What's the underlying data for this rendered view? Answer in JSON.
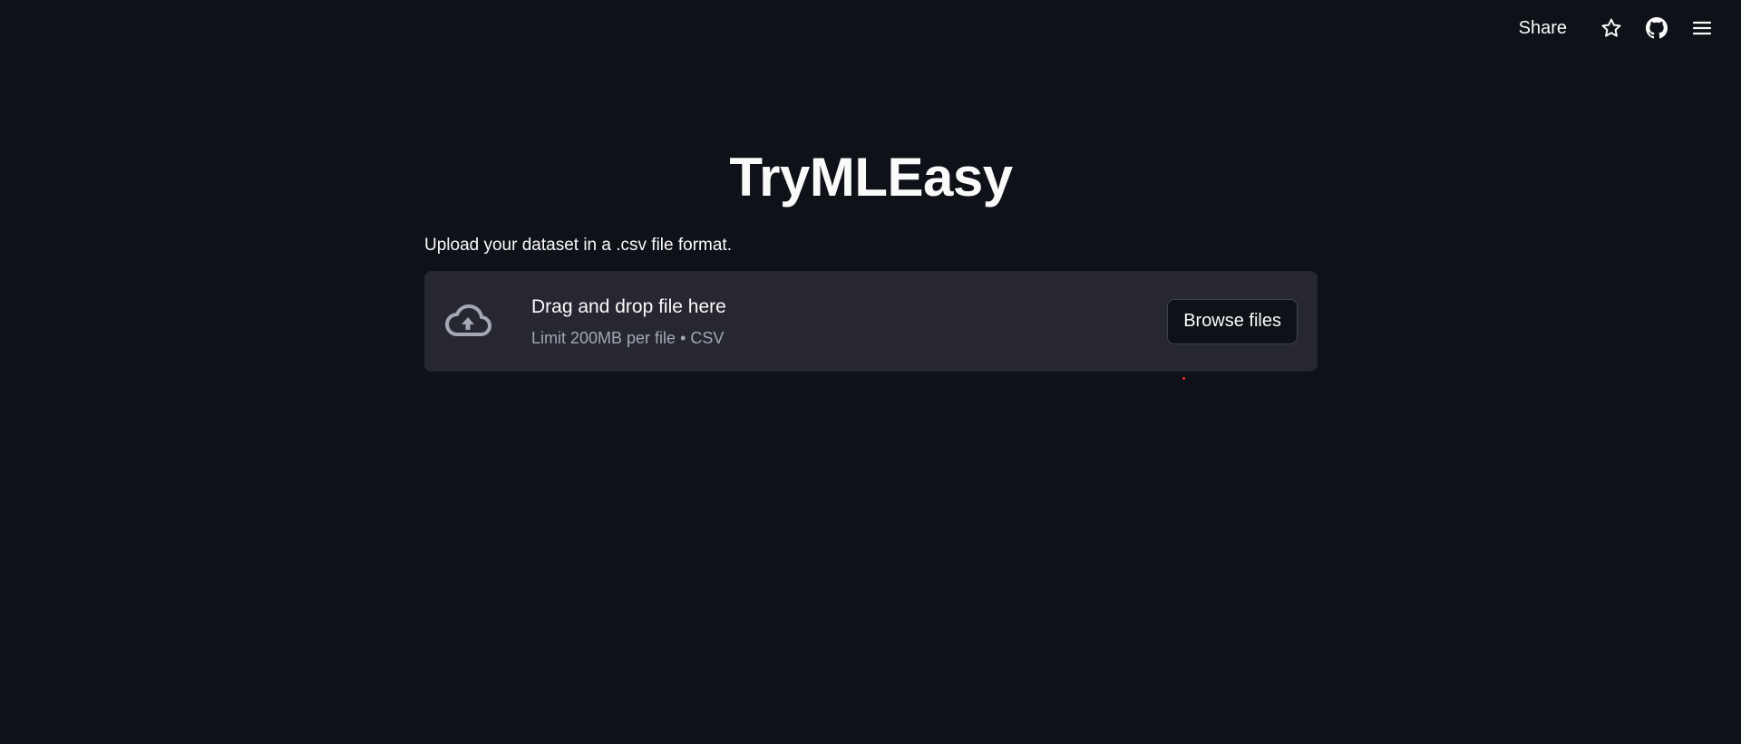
{
  "toolbar": {
    "share_label": "Share",
    "star_icon": "star-icon",
    "github_icon": "github-icon",
    "menu_icon": "hamburger-menu-icon"
  },
  "main": {
    "title": "TryMLEasy",
    "upload_label": "Upload your dataset in a .csv file format."
  },
  "uploader": {
    "icon": "cloud-upload-icon",
    "drop_text": "Drag and drop file here",
    "limit_text": "Limit 200MB per file • CSV",
    "browse_label": "Browse files"
  },
  "colors": {
    "background": "#0e1117",
    "dropzone": "#262730",
    "text": "#fafafa",
    "muted_text": "#a3a8b4"
  }
}
